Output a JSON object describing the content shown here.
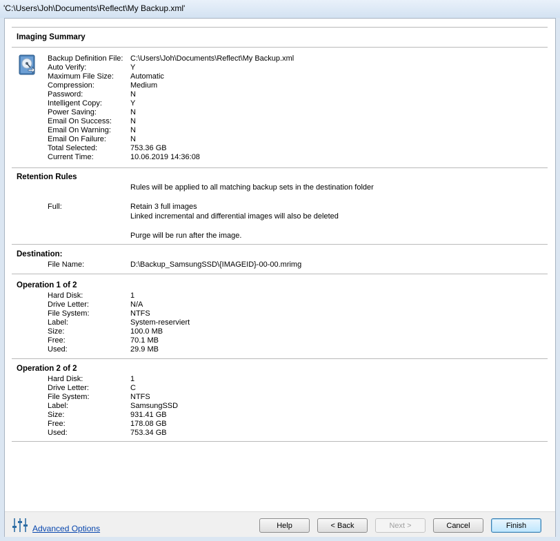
{
  "window": {
    "title": "'C:\\Users\\Joh\\Documents\\Reflect\\My Backup.xml'"
  },
  "summary": {
    "heading": "Imaging Summary",
    "rows": [
      {
        "label": "Backup Definition File:",
        "value": "C:\\Users\\Joh\\Documents\\Reflect\\My Backup.xml"
      },
      {
        "label": "Auto Verify:",
        "value": "Y"
      },
      {
        "label": "Maximum File Size:",
        "value": "Automatic"
      },
      {
        "label": "Compression:",
        "value": "Medium"
      },
      {
        "label": "Password:",
        "value": "N"
      },
      {
        "label": "Intelligent Copy:",
        "value": "Y"
      },
      {
        "label": "Power Saving:",
        "value": "N"
      },
      {
        "label": "Email On Success:",
        "value": "N"
      },
      {
        "label": "Email On Warning:",
        "value": "N"
      },
      {
        "label": "Email On Failure:",
        "value": "N"
      },
      {
        "label": "Total Selected:",
        "value": "753.36 GB"
      },
      {
        "label": "Current Time:",
        "value": "10.06.2019 14:36:08"
      }
    ]
  },
  "retention": {
    "heading": "Retention Rules",
    "intro": "Rules will be applied to all matching backup sets in the destination folder",
    "full_label": "Full:",
    "full_line1": "Retain 3 full images",
    "full_line2": "Linked incremental and differential images will also be deleted",
    "purge": "Purge will be run after the image."
  },
  "destination": {
    "heading": "Destination:",
    "file_label": "File Name:",
    "file_value": "D:\\Backup_SamsungSSD\\{IMAGEID}-00-00.mrimg"
  },
  "operations": [
    {
      "heading": "Operation 1 of 2",
      "rows": [
        {
          "label": "Hard Disk:",
          "value": "1"
        },
        {
          "label": "Drive Letter:",
          "value": "N/A"
        },
        {
          "label": "File System:",
          "value": "NTFS"
        },
        {
          "label": "Label:",
          "value": "System-reserviert"
        },
        {
          "label": "Size:",
          "value": "100.0 MB"
        },
        {
          "label": "Free:",
          "value": "70.1 MB"
        },
        {
          "label": "Used:",
          "value": "29.9 MB"
        }
      ]
    },
    {
      "heading": "Operation 2 of 2",
      "rows": [
        {
          "label": "Hard Disk:",
          "value": "1"
        },
        {
          "label": "Drive Letter:",
          "value": "C"
        },
        {
          "label": "File System:",
          "value": "NTFS"
        },
        {
          "label": "Label:",
          "value": "SamsungSSD"
        },
        {
          "label": "Size:",
          "value": "931.41 GB"
        },
        {
          "label": "Free:",
          "value": "178.08 GB"
        },
        {
          "label": "Used:",
          "value": "753.34 GB"
        }
      ]
    }
  ],
  "footer": {
    "advanced_label": "Advanced Options",
    "advanced_icon": "sliders-icon",
    "buttons": {
      "help": "Help",
      "back": "< Back",
      "next": "Next >",
      "cancel": "Cancel",
      "finish": "Finish"
    }
  },
  "icons": {
    "summary": "hard-disk-backup-icon"
  }
}
